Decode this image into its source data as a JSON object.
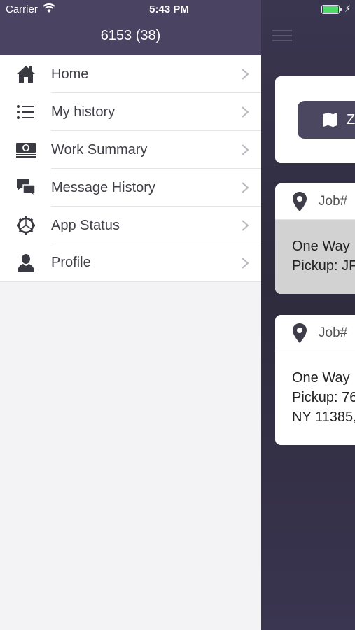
{
  "status_bar": {
    "carrier": "Carrier",
    "time": "5:43 PM"
  },
  "drawer": {
    "title": "6153 (38)",
    "items": [
      {
        "label": "Home",
        "icon": "home-icon"
      },
      {
        "label": "My history",
        "icon": "list-icon"
      },
      {
        "label": "Work Summary",
        "icon": "money-icon"
      },
      {
        "label": "Message History",
        "icon": "chat-icon"
      },
      {
        "label": "App Status",
        "icon": "gear-icon"
      },
      {
        "label": "Profile",
        "icon": "person-icon"
      }
    ]
  },
  "background": {
    "zoom_button_label": "Z",
    "jobs": [
      {
        "header": "Job#",
        "line1": "One Way",
        "line2": "Pickup: JF"
      },
      {
        "header": "Job#",
        "line1": "One Way",
        "line2": "Pickup: 76",
        "line3": "NY 11385,"
      }
    ]
  },
  "colors": {
    "header": "#4a4462",
    "accent_button": "#4b4760",
    "battery": "#4cd964"
  }
}
